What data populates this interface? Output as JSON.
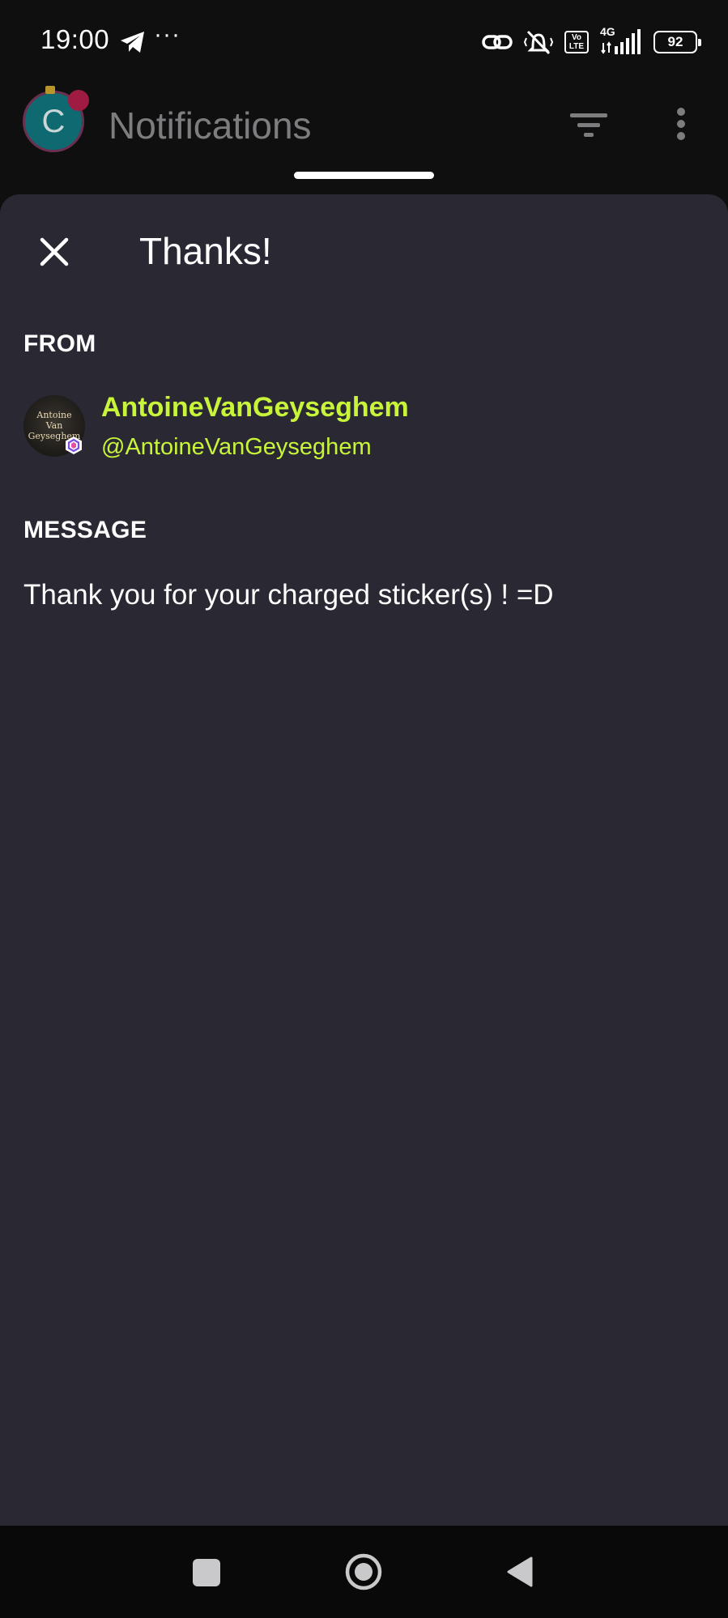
{
  "status_bar": {
    "time": "19:00",
    "overflow": "···",
    "network": "4G",
    "volte": "Vo\nLTE",
    "battery_level": "92",
    "icons": [
      "telegram-icon",
      "link-icon",
      "vibrate-silent-icon",
      "volte-icon",
      "signal-icon",
      "battery-icon"
    ]
  },
  "app_header": {
    "avatar_letter": "C",
    "title": "Notifications"
  },
  "sheet": {
    "title": "Thanks!",
    "from_label": "FROM",
    "sender": {
      "avatar_text": "Antoine\nVan\nGeyseghem",
      "name": "AntoineVanGeyseghem",
      "handle": "@AntoineVanGeyseghem"
    },
    "message_label": "MESSAGE",
    "message": "Thank you for your charged sticker(s) ! =D"
  },
  "colors": {
    "accent": "#c8f53a",
    "sheet_bg": "#2a2833",
    "app_bg": "#0f0f10"
  }
}
